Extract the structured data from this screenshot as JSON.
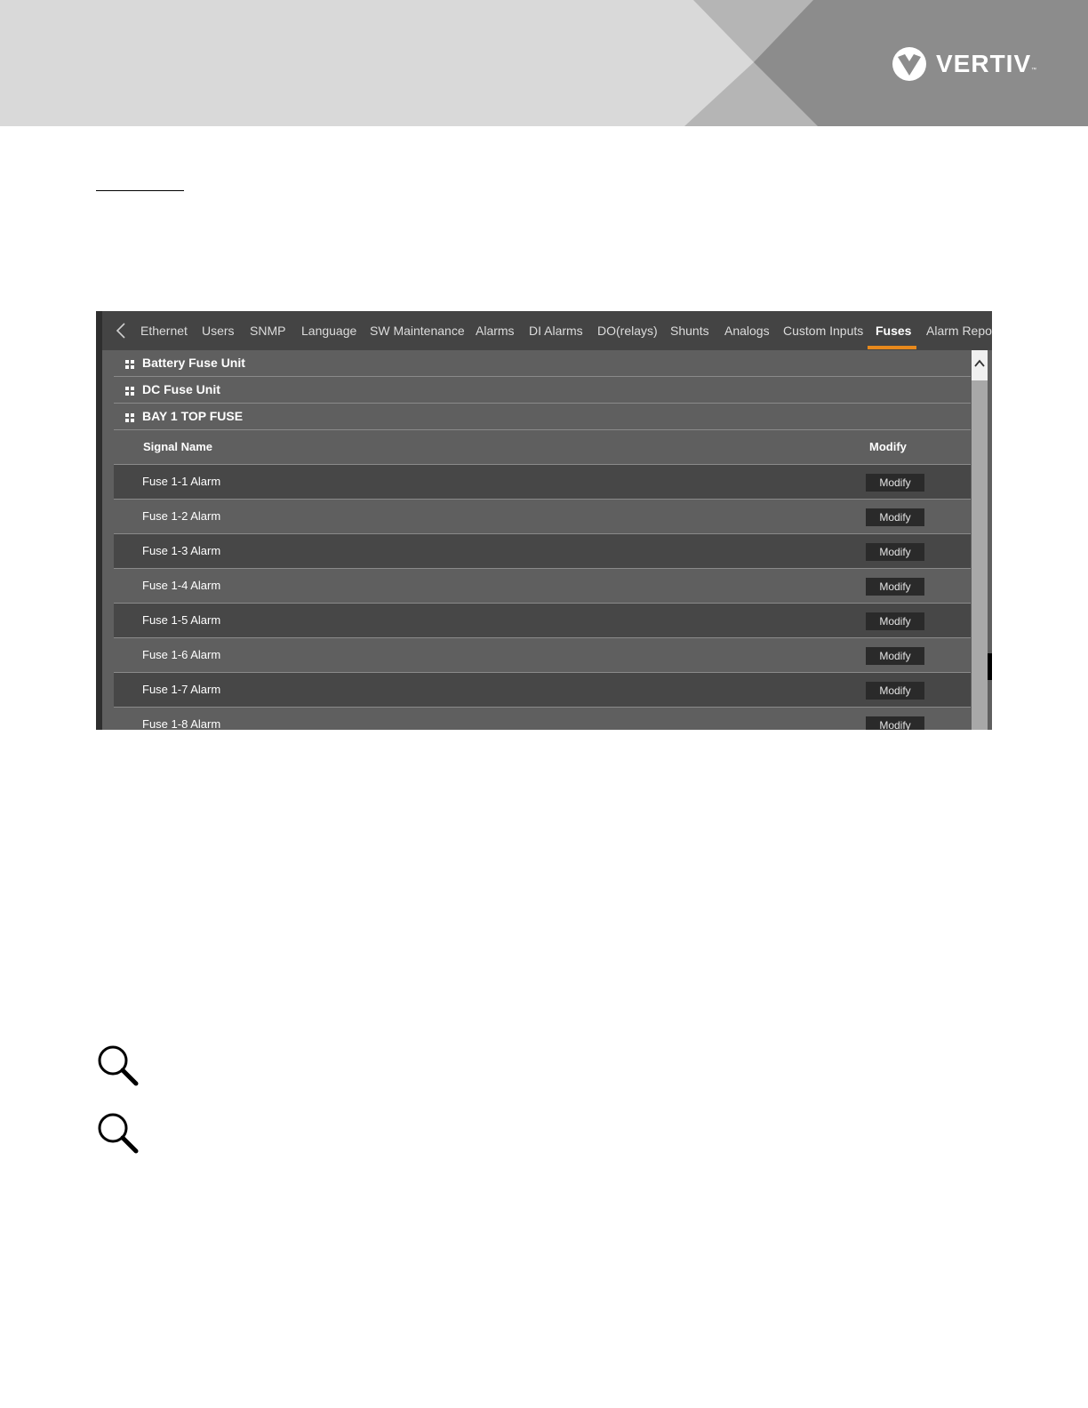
{
  "brand": {
    "logo_text": "VERTIV",
    "trademark": "™",
    "logo_icon": "vertiv-logo-icon",
    "banner_color": "#d9d9d9"
  },
  "ui": {
    "tabs": [
      {
        "label": "Ethernet"
      },
      {
        "label": "Users"
      },
      {
        "label": "SNMP"
      },
      {
        "label": "Language"
      },
      {
        "label": "SW Maintenance"
      },
      {
        "label": "Alarms"
      },
      {
        "label": "DI Alarms"
      },
      {
        "label": "DO(relays)"
      },
      {
        "label": "Shunts"
      },
      {
        "label": "Analogs"
      },
      {
        "label": "Custom Inputs"
      },
      {
        "label": "Fuses"
      },
      {
        "label": "Alarm Repo"
      }
    ],
    "active_tab": "Fuses",
    "accent_color": "#e8891c",
    "sections": [
      {
        "label": "Battery Fuse Unit"
      },
      {
        "label": "DC Fuse Unit"
      },
      {
        "label": "BAY 1 TOP FUSE"
      }
    ],
    "table": {
      "columns": [
        "Signal Name",
        "Modify"
      ],
      "rows": [
        {
          "name": "Fuse 1-1 Alarm",
          "action": "Modify"
        },
        {
          "name": "Fuse 1-2 Alarm",
          "action": "Modify"
        },
        {
          "name": "Fuse 1-3 Alarm",
          "action": "Modify"
        },
        {
          "name": "Fuse 1-4 Alarm",
          "action": "Modify"
        },
        {
          "name": "Fuse 1-5 Alarm",
          "action": "Modify"
        },
        {
          "name": "Fuse 1-6 Alarm",
          "action": "Modify"
        },
        {
          "name": "Fuse 1-7 Alarm",
          "action": "Modify"
        },
        {
          "name": "Fuse 1-8 Alarm",
          "action": "Modify"
        }
      ]
    }
  },
  "notes": [
    {
      "icon": "magnifier-icon"
    },
    {
      "icon": "magnifier-icon"
    }
  ]
}
